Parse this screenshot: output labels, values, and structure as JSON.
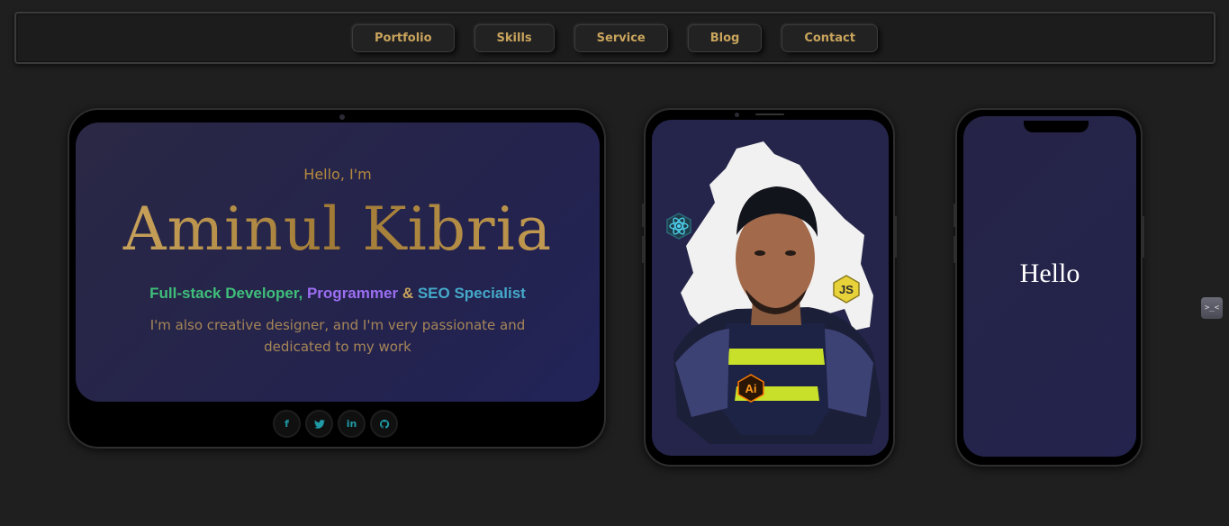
{
  "nav": {
    "items": [
      {
        "label": "Portfolio"
      },
      {
        "label": "Skills"
      },
      {
        "label": "Service"
      },
      {
        "label": "Blog"
      },
      {
        "label": "Contact"
      }
    ]
  },
  "hero": {
    "greeting": "Hello, I'm",
    "name": "Aminul Kibria",
    "roles": {
      "role1": "Full-stack Developer,",
      "role2": "Programmer",
      "amp": "&",
      "role3": "SEO Specialist"
    },
    "tagline": "I'm also creative designer, and I'm very passionate and dedicated to my work"
  },
  "socials": [
    {
      "icon": "facebook-icon",
      "glyph": "f"
    },
    {
      "icon": "twitter-icon",
      "glyph": "t"
    },
    {
      "icon": "linkedin-icon",
      "glyph": "in"
    },
    {
      "icon": "github-icon",
      "glyph": "g"
    }
  ],
  "tech_badges": [
    {
      "icon": "react-icon"
    },
    {
      "icon": "javascript-icon",
      "label": "JS"
    },
    {
      "icon": "illustrator-icon",
      "label": "Ai"
    }
  ],
  "phone": {
    "text": "Hello"
  },
  "edge_widget": {
    "label": ">_<"
  },
  "colors": {
    "background": "#1f1f1f",
    "gold": "#c9a45c",
    "green": "#3fbf7a",
    "purple": "#9b6ef2",
    "teal": "#45a9c9",
    "screen": "#24234d"
  }
}
